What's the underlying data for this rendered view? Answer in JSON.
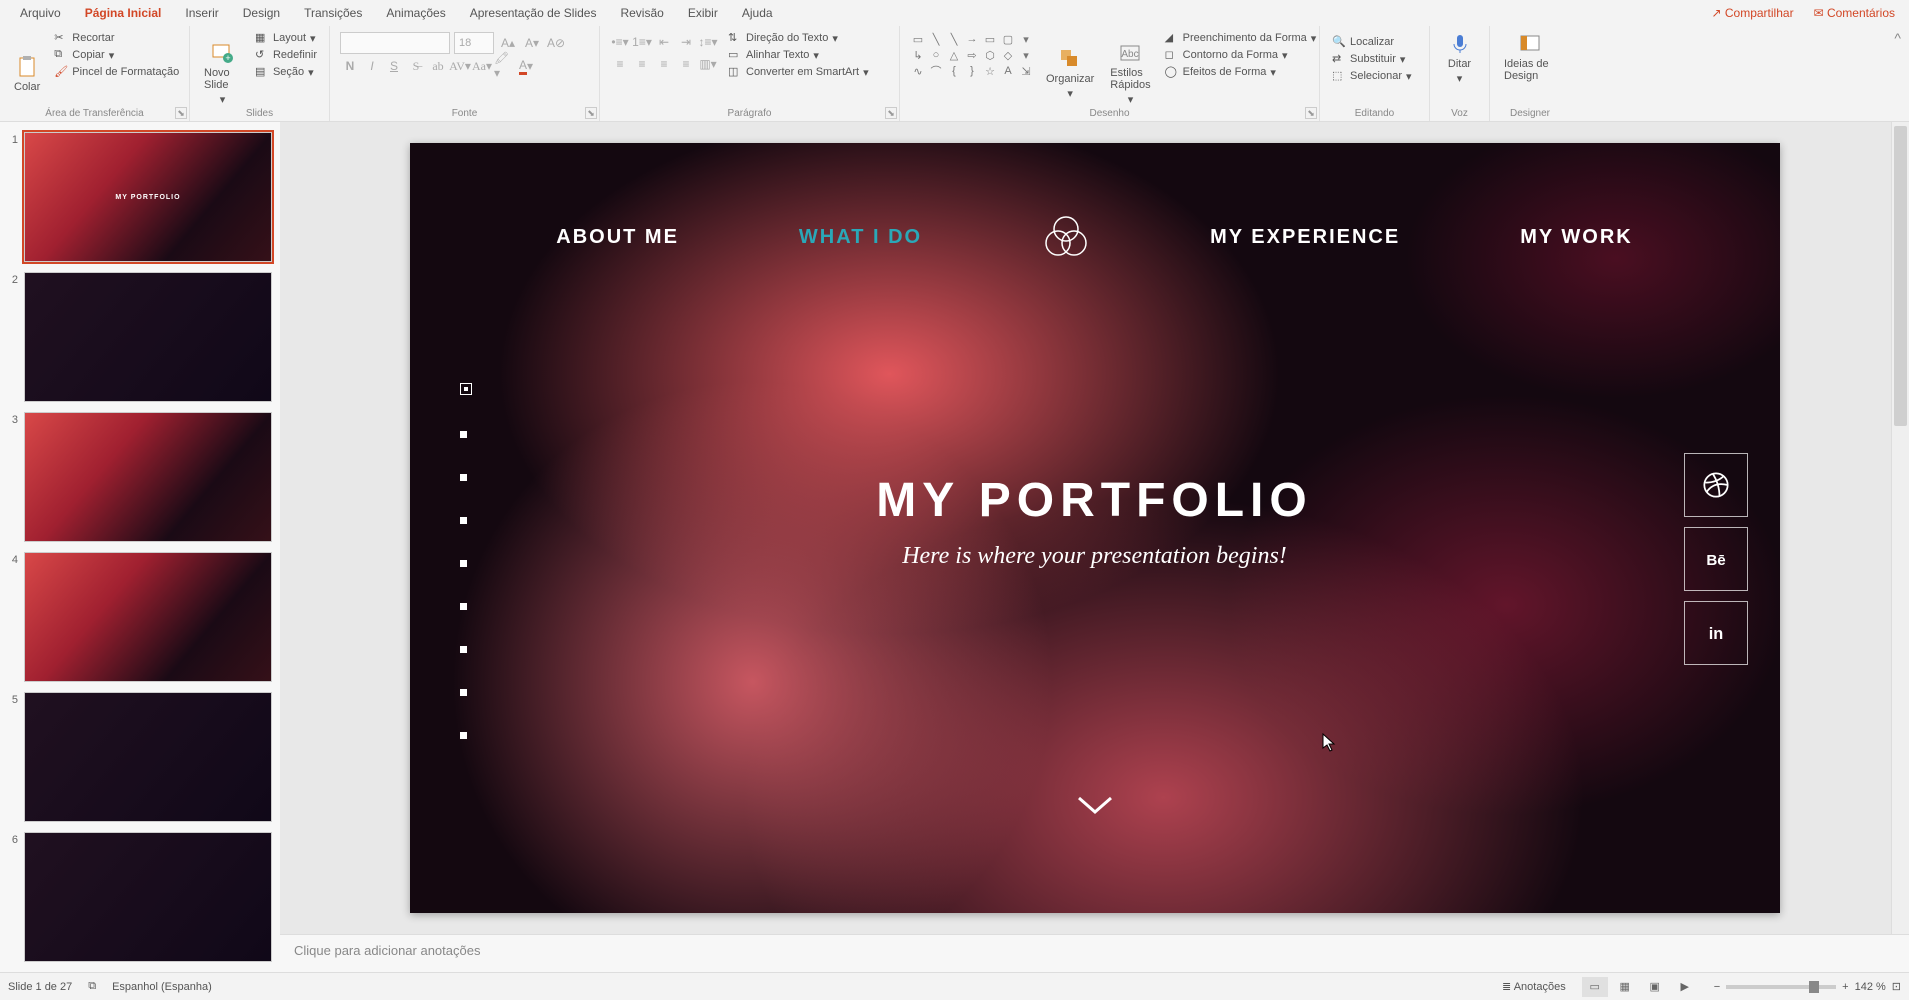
{
  "tabs": {
    "file": "Arquivo",
    "home": "Página Inicial",
    "insert": "Inserir",
    "design": "Design",
    "transitions": "Transições",
    "animations": "Animações",
    "slideshow": "Apresentação de Slides",
    "review": "Revisão",
    "view": "Exibir",
    "help": "Ajuda"
  },
  "header_actions": {
    "share": "Compartilhar",
    "comments": "Comentários"
  },
  "ribbon": {
    "clipboard": {
      "label": "Área de Transferência",
      "paste": "Colar",
      "cut": "Recortar",
      "copy": "Copiar",
      "painter": "Pincel de Formatação"
    },
    "slides": {
      "label": "Slides",
      "new_slide": "Novo Slide",
      "layout": "Layout",
      "reset": "Redefinir",
      "section": "Seção"
    },
    "font": {
      "label": "Fonte",
      "size": "18"
    },
    "paragraph": {
      "label": "Parágrafo",
      "text_dir": "Direção do Texto",
      "align_text": "Alinhar Texto",
      "smartart": "Converter em SmartArt"
    },
    "drawing": {
      "label": "Desenho",
      "arrange": "Organizar",
      "quick_styles": "Estilos Rápidos",
      "shape_fill": "Preenchimento da Forma",
      "shape_outline": "Contorno da Forma",
      "shape_effects": "Efeitos de Forma"
    },
    "editing": {
      "label": "Editando",
      "find": "Localizar",
      "replace": "Substituir",
      "select": "Selecionar"
    },
    "voice": {
      "label": "Voz",
      "dictate": "Ditar"
    },
    "designer": {
      "label": "Designer",
      "ideas": "Ideias de Design"
    }
  },
  "slide": {
    "nav": {
      "about": "ABOUT ME",
      "what": "WHAT I DO",
      "exp": "MY EXPERIENCE",
      "work": "MY WORK"
    },
    "title": "MY PORTFOLIO",
    "subtitle": "Here is where your presentation begins!"
  },
  "thumbnails": {
    "count": 6,
    "t1_title": "MY PORTFOLIO"
  },
  "notes_placeholder": "Clique para adicionar anotações",
  "status": {
    "slide_info": "Slide 1 de 27",
    "language": "Espanhol (Espanha)",
    "notes_btn": "Anotações",
    "zoom": "142 %"
  }
}
